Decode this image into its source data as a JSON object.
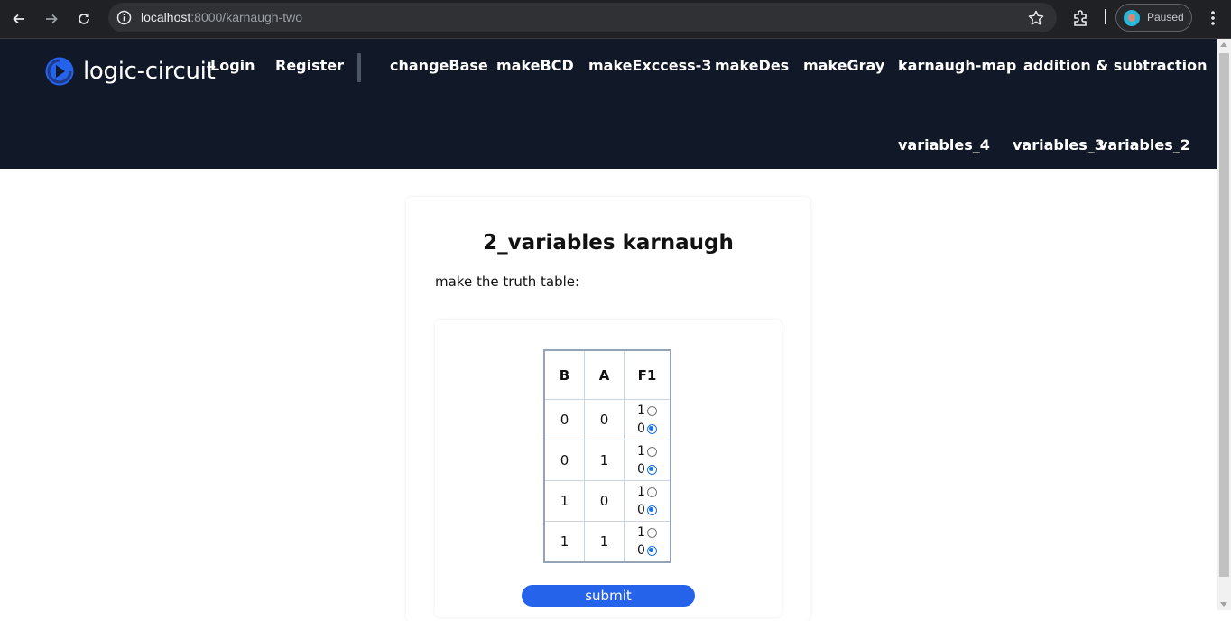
{
  "browser": {
    "url_host": "localhost",
    "url_path": ":8000/karnaugh-two",
    "profile_label": "Paused"
  },
  "site": {
    "logo_text": "logic-circuit",
    "nav": {
      "login": "Login",
      "register": "Register",
      "change_base": "changeBase",
      "make_bcd": "makeBCD",
      "make_excess3": "makeExccess-3",
      "make_des": "makeDes",
      "make_gray": "makeGray",
      "karnaugh_map": "karnaugh-map",
      "add_sub": "addition & subtraction",
      "variables_4": "variables_4",
      "variables_3": "variables_3",
      "variables_2": "variables_2"
    }
  },
  "card": {
    "title": "2_variables karnaugh",
    "instruction": "make the truth table:"
  },
  "truth_table": {
    "headers": [
      "B",
      "A",
      "F1"
    ],
    "rows": [
      {
        "b": "0",
        "a": "0",
        "opt1": "1",
        "opt0": "0",
        "selected": "0"
      },
      {
        "b": "0",
        "a": "1",
        "opt1": "1",
        "opt0": "0",
        "selected": "0"
      },
      {
        "b": "1",
        "a": "0",
        "opt1": "1",
        "opt0": "0",
        "selected": "0"
      },
      {
        "b": "1",
        "a": "1",
        "opt1": "1",
        "opt0": "0",
        "selected": "0"
      }
    ]
  },
  "submit_label": "submit",
  "colors": {
    "header_bg": "#111827",
    "accent": "#2563eb",
    "radio_checked": "#1a73e8"
  }
}
